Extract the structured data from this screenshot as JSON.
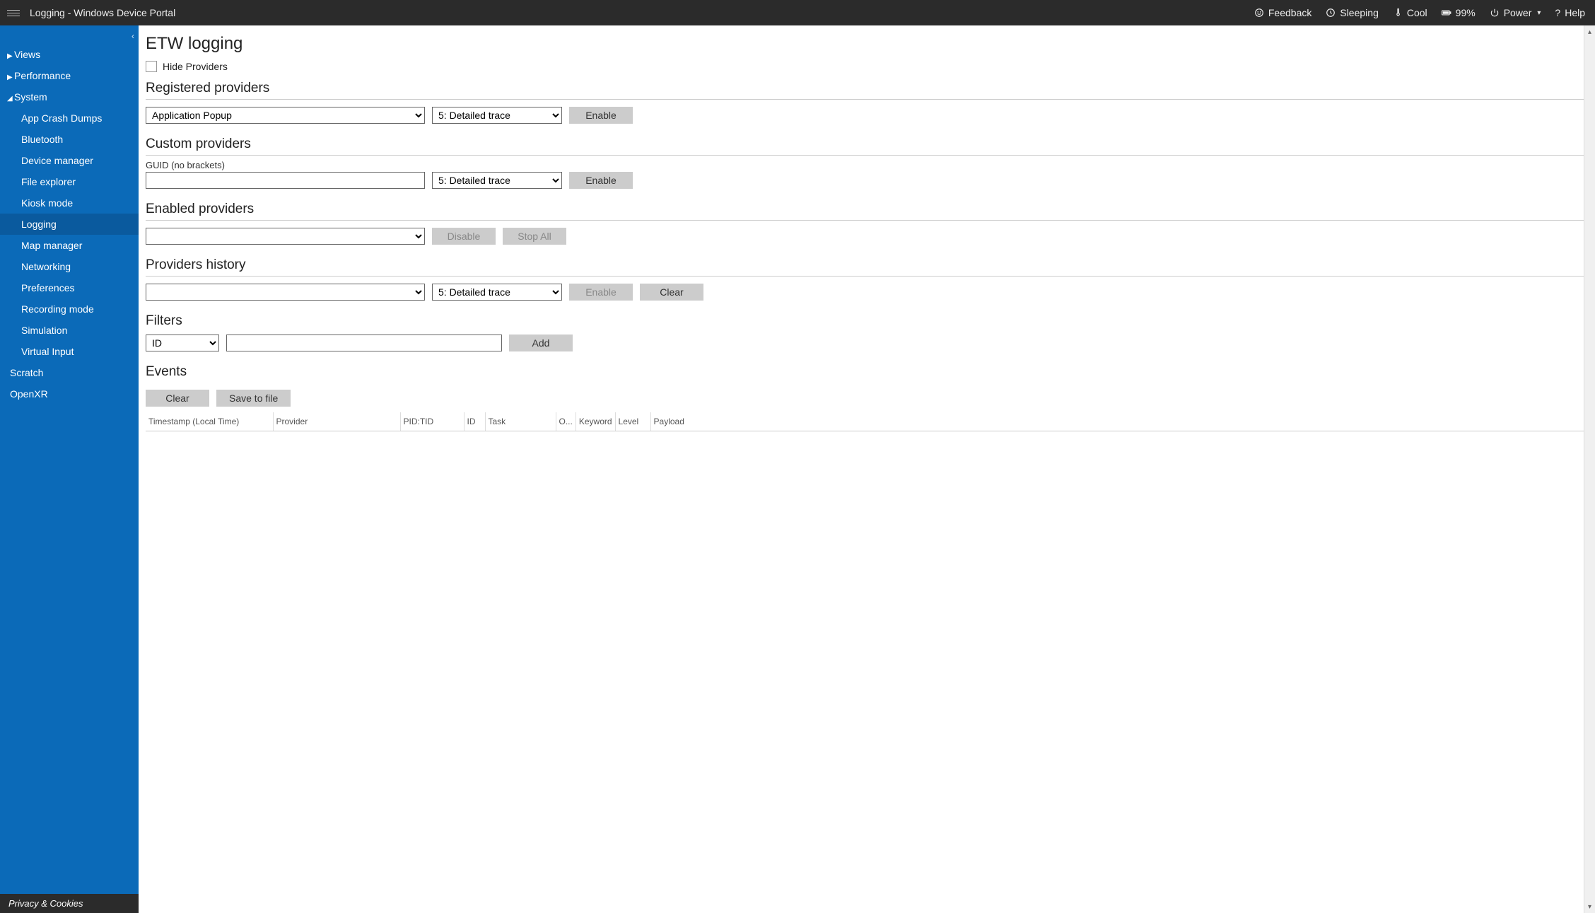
{
  "header": {
    "title": "Logging - Windows Device Portal",
    "feedback": "Feedback",
    "sleep": "Sleeping",
    "temp": "Cool",
    "battery": "99%",
    "power": "Power",
    "help": "Help"
  },
  "sidebar": {
    "groups": {
      "views": "Views",
      "performance": "Performance",
      "system": "System"
    },
    "system_items": [
      "App Crash Dumps",
      "Bluetooth",
      "Device manager",
      "File explorer",
      "Kiosk mode",
      "Logging",
      "Map manager",
      "Networking",
      "Preferences",
      "Recording mode",
      "Simulation",
      "Virtual Input"
    ],
    "bottom_items": {
      "scratch": "Scratch",
      "openxr": "OpenXR"
    },
    "footer": "Privacy & Cookies"
  },
  "page": {
    "title": "ETW logging",
    "hide_providers_label": "Hide Providers",
    "registered": {
      "heading": "Registered providers",
      "provider_selected": "Application Popup",
      "level_selected": "5: Detailed trace",
      "enable": "Enable"
    },
    "custom": {
      "heading": "Custom providers",
      "guid_label": "GUID (no brackets)",
      "level_selected": "5: Detailed trace",
      "enable": "Enable"
    },
    "enabled": {
      "heading": "Enabled providers",
      "disable": "Disable",
      "stop_all": "Stop All"
    },
    "history": {
      "heading": "Providers history",
      "level_selected": "5: Detailed trace",
      "enable": "Enable",
      "clear": "Clear"
    },
    "filters": {
      "heading": "Filters",
      "field_selected": "ID",
      "add": "Add"
    },
    "events": {
      "heading": "Events",
      "clear": "Clear",
      "save": "Save to file",
      "columns": [
        "Timestamp (Local Time)",
        "Provider",
        "PID:TID",
        "ID",
        "Task",
        "O...",
        "Keyword",
        "Level",
        "Payload"
      ]
    }
  }
}
